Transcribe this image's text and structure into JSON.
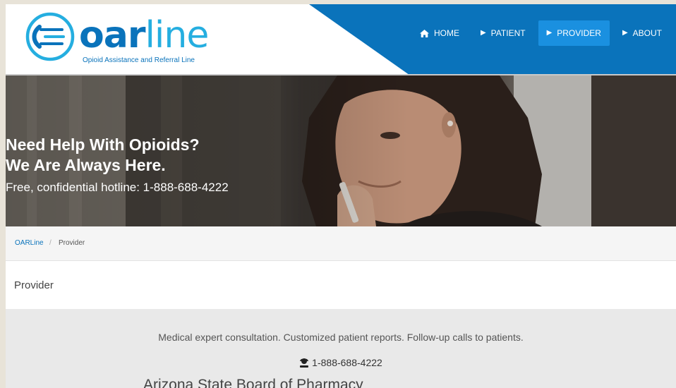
{
  "brand": {
    "name_bold": "oar",
    "name_thin": "line",
    "tagline": "Opioid Assistance and Referral Line",
    "primary_color": "#0a73bb",
    "accent_color": "#25aee0"
  },
  "nav": {
    "items": [
      {
        "label": "HOME",
        "icon": "home-icon",
        "active": false
      },
      {
        "label": "PATIENT",
        "icon": "caret-right-icon",
        "active": false
      },
      {
        "label": "PROVIDER",
        "icon": "caret-right-icon",
        "active": true
      },
      {
        "label": "ABOUT",
        "icon": "caret-right-icon",
        "active": false
      }
    ]
  },
  "hero": {
    "heading_line1": "Need Help With Opioids?",
    "heading_line2": "We Are Always Here.",
    "subtext": "Free, confidential hotline: 1-888-688-4222"
  },
  "breadcrumb": {
    "home": "OARLine",
    "separator": "/",
    "current": "Provider"
  },
  "page": {
    "title": "Provider"
  },
  "panel": {
    "description": "Medical expert consultation. Customized patient reports. Follow-up calls to patients.",
    "phone_icon": "phone-operator-icon",
    "phone": "1-888-688-4222",
    "org": "Arizona State Board of Pharmacy"
  }
}
